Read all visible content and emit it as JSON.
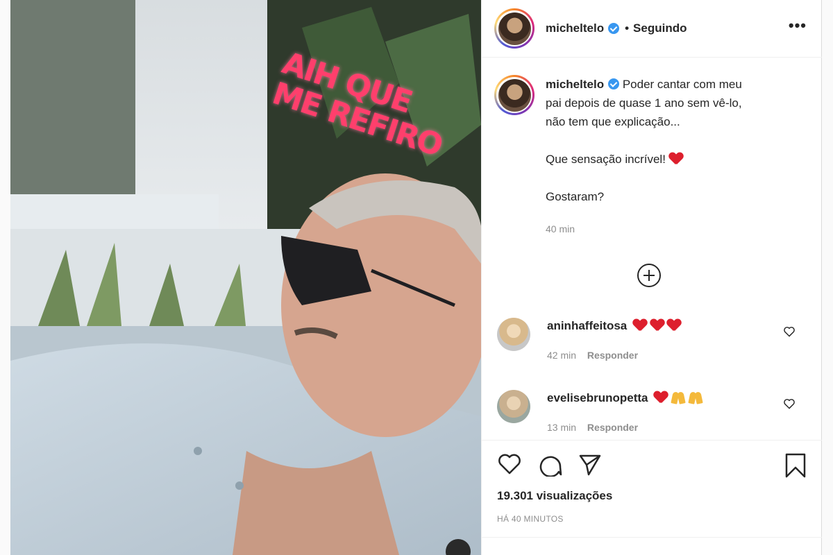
{
  "post": {
    "username": "micheltelo",
    "follow_separator": "•",
    "follow_state": "Seguindo",
    "more_label": "•••"
  },
  "media": {
    "sticker_line1": "AIH QUE",
    "sticker_line2": "ME REFIRO"
  },
  "caption": {
    "username": "micheltelo",
    "line1": "Poder cantar com meu",
    "line2": "pai depois de quase 1 ano sem vê-lo,",
    "line3": "não tem que explicação...",
    "line4": "Que sensação incrível!",
    "line5": "Gostaram?",
    "time": "40 min"
  },
  "comments": [
    {
      "username": "aninhaffeitosa",
      "time": "42 min",
      "reply": "Responder"
    },
    {
      "username": "evelisebrunopetta",
      "time": "13 min",
      "reply": "Responder"
    }
  ],
  "stats": {
    "views": "19.301 visualizações",
    "posted_ago": "HÁ 40 MINUTOS"
  },
  "colors": {
    "verified": "#3897f0",
    "heart_red": "#dd1f2d",
    "muted_text": "#8e8e8e"
  },
  "icons": [
    "heart-icon",
    "comment-icon",
    "share-icon",
    "bookmark-icon",
    "add-circle-icon",
    "more-icon",
    "verified-badge-icon"
  ]
}
